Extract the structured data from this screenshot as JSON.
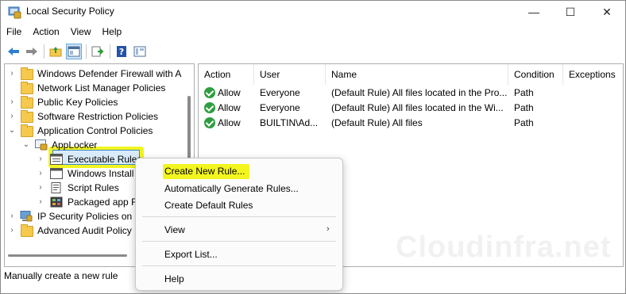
{
  "window": {
    "title": "Local Security Policy",
    "controls": {
      "minimize": "—",
      "maximize": "☐",
      "close": "✕"
    }
  },
  "menubar": [
    "File",
    "Action",
    "View",
    "Help"
  ],
  "toolbar": {
    "icons": [
      "back-arrow-icon",
      "forward-arrow-icon",
      "up-folder-icon",
      "show-hide-tree-icon",
      "export-list-icon",
      "help-icon",
      "properties-icon"
    ]
  },
  "tree": {
    "items": [
      {
        "label": "Windows Defender Firewall with A"
      },
      {
        "label": "Network List Manager Policies"
      },
      {
        "label": "Public Key Policies"
      },
      {
        "label": "Software Restriction Policies"
      },
      {
        "label": "Application Control Policies"
      },
      {
        "label": "AppLocker"
      },
      {
        "label": "Executable Rules"
      },
      {
        "label": "Windows Install"
      },
      {
        "label": "Script Rules"
      },
      {
        "label": "Packaged app R"
      },
      {
        "label": "IP Security Policies on L"
      },
      {
        "label": "Advanced Audit Policy"
      }
    ]
  },
  "list": {
    "columns": [
      "Action",
      "User",
      "Name",
      "Condition",
      "Exceptions"
    ],
    "rows": [
      {
        "action": "Allow",
        "user": "Everyone",
        "name": "(Default Rule) All files located in the Pro...",
        "condition": "Path",
        "exceptions": ""
      },
      {
        "action": "Allow",
        "user": "Everyone",
        "name": "(Default Rule) All files located in the Wi...",
        "condition": "Path",
        "exceptions": ""
      },
      {
        "action": "Allow",
        "user": "BUILTIN\\Ad...",
        "name": "(Default Rule) All files",
        "condition": "Path",
        "exceptions": ""
      }
    ]
  },
  "context_menu": {
    "items": [
      "Create New Rule...",
      "Automatically Generate Rules...",
      "Create Default Rules",
      "View",
      "Export List...",
      "Help"
    ],
    "submenu_arrow": "›"
  },
  "status": {
    "text": "Manually create a new rule"
  },
  "watermark": "Cloudinfra.net",
  "colors": {
    "highlight": "#f3f51f",
    "selection": "#d9ebf9",
    "check": "#2f9e3f"
  }
}
